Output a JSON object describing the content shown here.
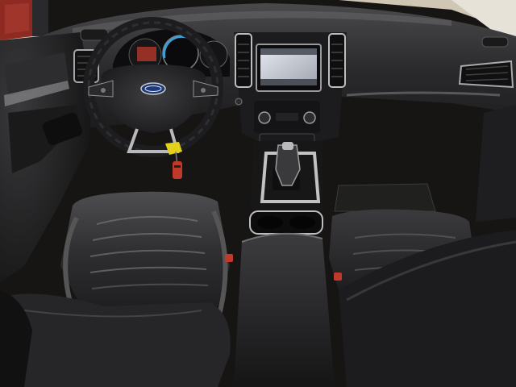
{
  "scene": {
    "description_free": true,
    "brand_emblem": "Ford",
    "colors": {
      "leather": "#2b2b2d",
      "leather_highlight": "#6d6d70",
      "dashboard": "#1f1f21",
      "trim_silver": "#b9b9bb",
      "screen": "#c9ccd4",
      "carpet": "#161514",
      "wall": "#cfc6b4",
      "exterior_red": "#8e2a22",
      "tag_yellow": "#e3d21c",
      "key_red": "#c0392b",
      "gauge_blue": "#3aa0d8"
    }
  }
}
